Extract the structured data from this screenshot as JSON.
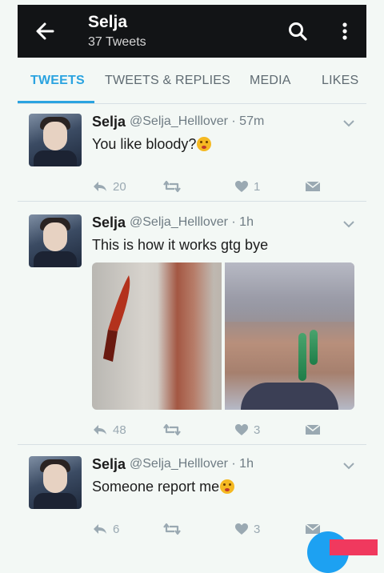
{
  "header": {
    "title": "Selja",
    "subtitle": "37 Tweets"
  },
  "tabs": [
    {
      "label": "TWEETS",
      "active": true
    },
    {
      "label": "TWEETS & REPLIES",
      "active": false
    },
    {
      "label": "MEDIA",
      "active": false
    },
    {
      "label": "LIKES",
      "active": false
    }
  ],
  "tweets": [
    {
      "name": "Selja",
      "handle": "@Selja_Helllover · 57m",
      "text": "You like bloody?",
      "has_emoji": true,
      "replies": "20",
      "retweets": "",
      "likes": "1"
    },
    {
      "name": "Selja",
      "handle": "@Selja_Helllover · 1h",
      "text": "This is how it works gtg bye",
      "has_emoji": false,
      "replies": "48",
      "retweets": "",
      "likes": "3"
    },
    {
      "name": "Selja",
      "handle": "@Selja_Helllover · 1h",
      "text": "Someone report me",
      "has_emoji": true,
      "replies": "6",
      "retweets": "",
      "likes": "3"
    }
  ],
  "colors": {
    "accent": "#2aa3e0",
    "header_bg": "#121416",
    "background": "#f3f8f5"
  }
}
